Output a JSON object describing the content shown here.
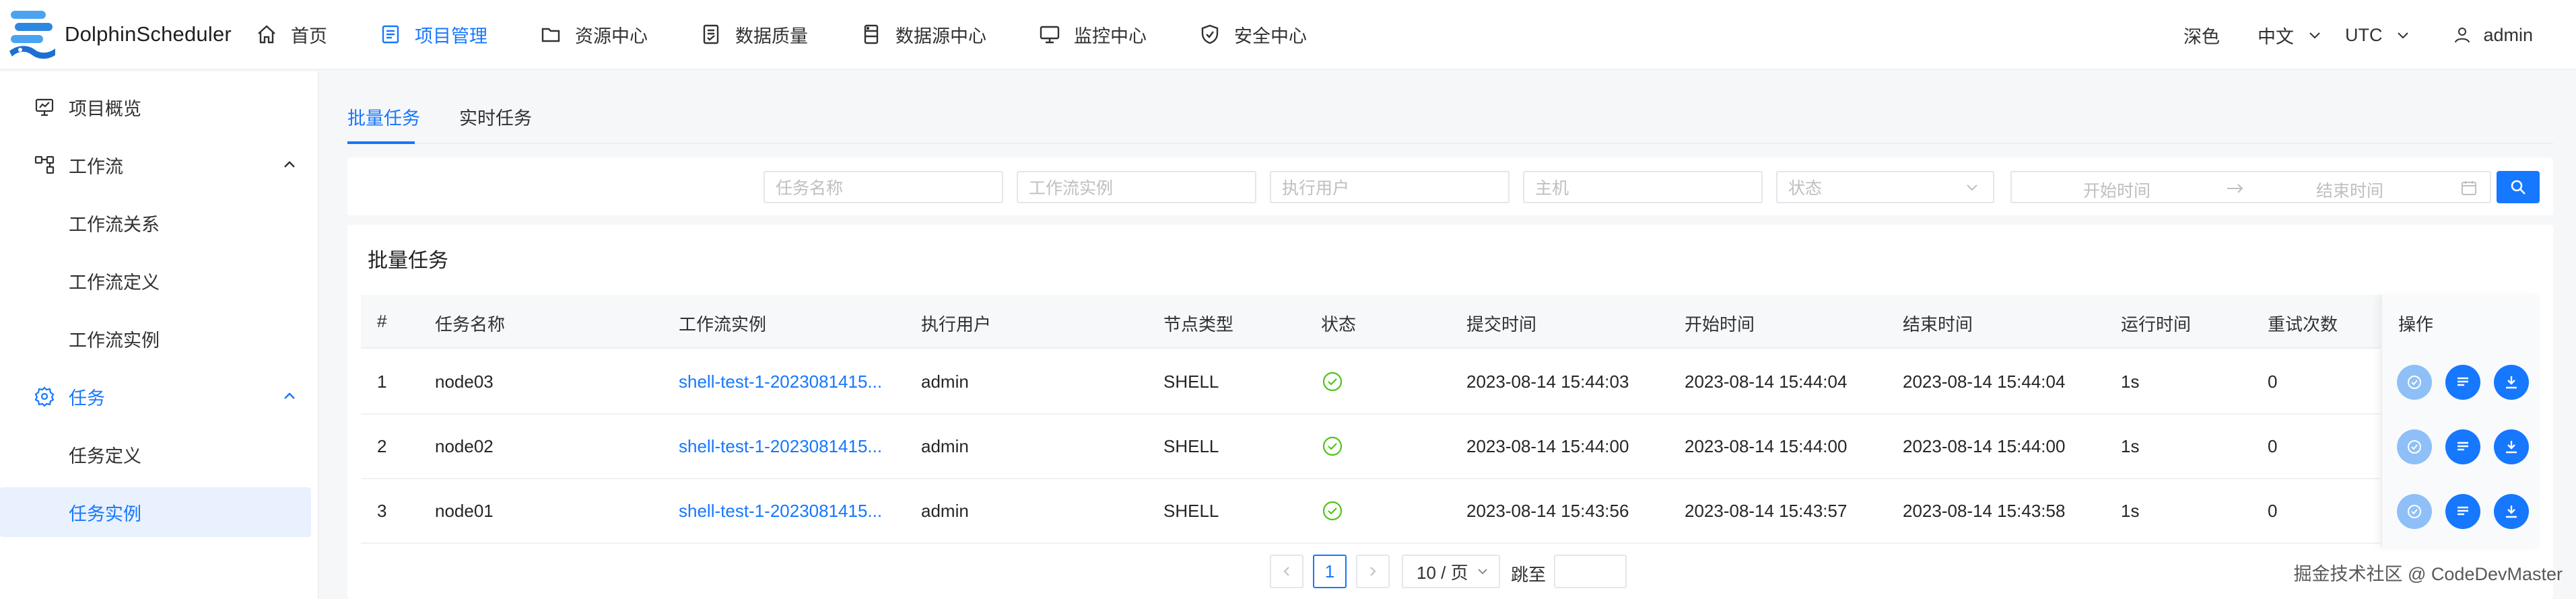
{
  "app": {
    "name": "DolphinScheduler"
  },
  "nav": {
    "items": [
      {
        "label": "首页",
        "icon": "home-icon"
      },
      {
        "label": "项目管理",
        "icon": "project-list-icon",
        "active": true
      },
      {
        "label": "资源中心",
        "icon": "folder-icon"
      },
      {
        "label": "数据质量",
        "icon": "quality-doc-icon"
      },
      {
        "label": "数据源中心",
        "icon": "datasource-icon"
      },
      {
        "label": "监控中心",
        "icon": "monitor-icon"
      },
      {
        "label": "安全中心",
        "icon": "shield-icon"
      }
    ],
    "theme": "深色",
    "language": "中文",
    "timezone": "UTC",
    "user": "admin"
  },
  "sidebar": {
    "items": [
      {
        "label": "项目概览"
      },
      {
        "label": "工作流"
      },
      {
        "label": "工作流关系"
      },
      {
        "label": "工作流定义"
      },
      {
        "label": "工作流实例"
      },
      {
        "label": "任务"
      },
      {
        "label": "任务定义"
      },
      {
        "label": "任务实例",
        "selected": true
      }
    ]
  },
  "tabs": [
    {
      "label": "批量任务",
      "active": true
    },
    {
      "label": "实时任务"
    }
  ],
  "filters": {
    "task_name": "任务名称",
    "workflow_instance": "工作流实例",
    "executor": "执行用户",
    "host": "主机",
    "state": "状态",
    "start_time": "开始时间",
    "end_time": "结束时间"
  },
  "card": {
    "title": "批量任务"
  },
  "table": {
    "headers": [
      "#",
      "任务名称",
      "工作流实例",
      "执行用户",
      "节点类型",
      "状态",
      "提交时间",
      "开始时间",
      "结束时间",
      "运行时间",
      "重试次数",
      "操作"
    ],
    "rows": [
      {
        "index": "1",
        "name": "node03",
        "instance": "shell-test-1-2023081415...",
        "user": "admin",
        "type": "SHELL",
        "state": "success",
        "submit": "2023-08-14 15:44:03",
        "start": "2023-08-14 15:44:04",
        "end": "2023-08-14 15:44:04",
        "duration": "1s",
        "retry": "0"
      },
      {
        "index": "2",
        "name": "node02",
        "instance": "shell-test-1-2023081415...",
        "user": "admin",
        "type": "SHELL",
        "state": "success",
        "submit": "2023-08-14 15:44:00",
        "start": "2023-08-14 15:44:00",
        "end": "2023-08-14 15:44:00",
        "duration": "1s",
        "retry": "0"
      },
      {
        "index": "3",
        "name": "node01",
        "instance": "shell-test-1-2023081415...",
        "user": "admin",
        "type": "SHELL",
        "state": "success",
        "submit": "2023-08-14 15:43:56",
        "start": "2023-08-14 15:43:57",
        "end": "2023-08-14 15:43:58",
        "duration": "1s",
        "retry": "0"
      }
    ]
  },
  "pagination": {
    "current": "1",
    "page_size": "10 / 页",
    "jump_label": "跳至"
  },
  "watermark": "掘金技术社区 @ CodeDevMaster",
  "colors": {
    "primary": "#1677ff",
    "success": "#52c41a"
  }
}
